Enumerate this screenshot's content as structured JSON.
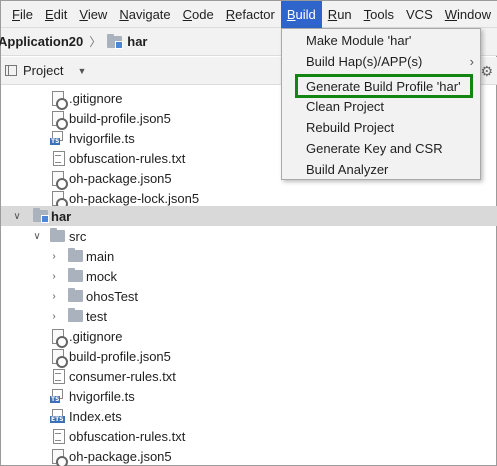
{
  "menubar": {
    "items": [
      {
        "mnemonic": "F",
        "rest": "ile"
      },
      {
        "mnemonic": "E",
        "rest": "dit"
      },
      {
        "mnemonic": "V",
        "rest": "iew"
      },
      {
        "mnemonic": "N",
        "rest": "avigate"
      },
      {
        "mnemonic": "C",
        "rest": "ode"
      },
      {
        "mnemonic": "R",
        "rest": "efactor"
      },
      {
        "mnemonic": "B",
        "rest": "uild"
      },
      {
        "mnemonic": "R",
        "rest": "un"
      },
      {
        "mnemonic": "T",
        "rest": "ools"
      },
      {
        "mnemonic": "",
        "rest": "VCS"
      },
      {
        "mnemonic": "W",
        "rest": "indow"
      }
    ],
    "active_index": 6
  },
  "navbar": {
    "project": "Application20",
    "separator": "〉",
    "module": "har"
  },
  "project_panel": {
    "label": "Project",
    "caret": "▼",
    "gear": "⚙"
  },
  "tree": {
    "rows": [
      {
        "label": ".gitignore",
        "icon": "settings-file-icon"
      },
      {
        "label": "build-profile.json5",
        "icon": "settings-file-icon"
      },
      {
        "label": "hvigorfile.ts",
        "icon": "ts-file-icon",
        "tag": "TS"
      },
      {
        "label": "obfuscation-rules.txt",
        "icon": "text-file-icon"
      },
      {
        "label": "oh-package.json5",
        "icon": "settings-file-icon"
      },
      {
        "label": "oh-package-lock.json5",
        "icon": "settings-file-icon"
      },
      {
        "label": "har",
        "icon": "module-folder-icon",
        "expanded": true,
        "selected": true
      },
      {
        "label": "src",
        "icon": "folder-icon",
        "expanded": true
      },
      {
        "label": "main",
        "icon": "folder-icon",
        "expanded": false
      },
      {
        "label": "mock",
        "icon": "folder-icon",
        "expanded": false
      },
      {
        "label": "ohosTest",
        "icon": "folder-icon",
        "expanded": false
      },
      {
        "label": "test",
        "icon": "folder-icon",
        "expanded": false
      },
      {
        "label": ".gitignore",
        "icon": "settings-file-icon"
      },
      {
        "label": "build-profile.json5",
        "icon": "settings-file-icon"
      },
      {
        "label": "consumer-rules.txt",
        "icon": "text-file-icon"
      },
      {
        "label": "hvigorfile.ts",
        "icon": "ts-file-icon",
        "tag": "TS"
      },
      {
        "label": "Index.ets",
        "icon": "ets-file-icon",
        "tag": "ETS"
      },
      {
        "label": "obfuscation-rules.txt",
        "icon": "text-file-icon"
      },
      {
        "label": "oh-package.json5",
        "icon": "settings-file-icon"
      }
    ]
  },
  "build_menu": {
    "items": [
      {
        "label": "Make Module 'har'"
      },
      {
        "label": "Build Hap(s)/APP(s)",
        "submenu_arrow": "›"
      },
      {
        "label": "Generate Build Profile 'har'",
        "highlighted": true
      },
      {
        "label": "Clean Project"
      },
      {
        "label": "Rebuild Project"
      },
      {
        "label": "Generate Key and CSR"
      },
      {
        "label": "Build Analyzer"
      }
    ],
    "highlight_color": "#138513"
  },
  "colors": {
    "menu_active_bg": "#2f65ca",
    "selected_row_bg": "#d9d9d9",
    "folder": "#a9b2bd",
    "file_tag": "#3b6fb6"
  }
}
